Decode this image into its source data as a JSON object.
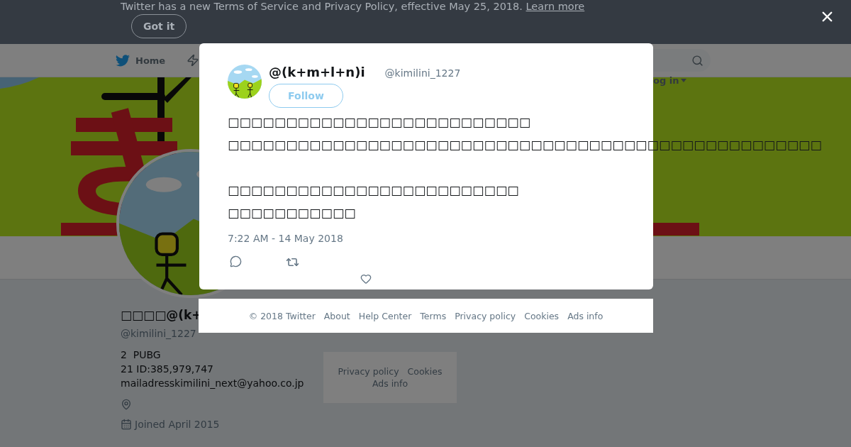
{
  "banner": {
    "message": "Twitter has a new Terms of Service and Privacy Policy, effective May 25, 2018.",
    "link": "Learn more",
    "button": "Got it"
  },
  "nav": {
    "home": "Home",
    "login": "og in"
  },
  "profile": {
    "name": "□□□□@(k+",
    "handle": "@kimilini_1227",
    "bio": [
      "2  PUBG",
      "21 ID:385,979,747",
      "mailadresskimilini_next@yahoo.co.jp"
    ],
    "joined": "Joined April 2015"
  },
  "side_footer": [
    "Privacy policy",
    "Cookies",
    "Ads info"
  ],
  "tweet": {
    "name": "@(k+m+l+n)i",
    "handle": "@kimilini_1227",
    "follow": "Follow",
    "paragraphs": [
      [
        "□□□□□□□□□□□□□□□□□□□□□□□□□□",
        "□□□□□□□□□□□□□□□□□□□□□□□□□□□□□□□□□□□□□□□□□□□□□□□□□□□"
      ],
      [
        "□□□□□□□□□□□□□□□□□□□□□□□□□",
        "□□□□□□□□□□□"
      ]
    ],
    "timestamp": "7:22 AM - 14 May 2018"
  },
  "footer": [
    "© 2018 Twitter",
    "About",
    "Help Center",
    "Terms",
    "Privacy policy",
    "Cookies",
    "Ads info"
  ]
}
